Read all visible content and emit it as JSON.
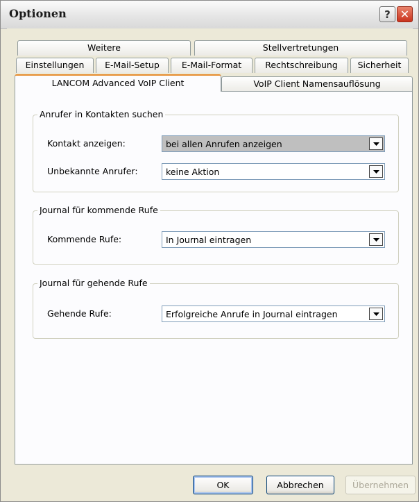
{
  "window": {
    "title": "Optionen"
  },
  "titlebar_buttons": {
    "help": "?",
    "close": "✕"
  },
  "tabs": {
    "row1": [
      "Weitere",
      "Stellvertretungen"
    ],
    "row2": [
      "Einstellungen",
      "E-Mail-Setup",
      "E-Mail-Format",
      "Rechtschreibung",
      "Sicherheit"
    ],
    "row3": [
      "LANCOM Advanced VoIP Client",
      "VoIP Client Namensauflösung"
    ],
    "active": "LANCOM Advanced VoIP Client"
  },
  "groups": {
    "contacts": {
      "title": "Anrufer in Kontakten suchen",
      "show_contact_label": "Kontakt anzeigen:",
      "show_contact_value": "bei allen Anrufen anzeigen",
      "unknown_callers_label": "Unbekannte Anrufer:",
      "unknown_callers_value": "keine Aktion"
    },
    "incoming": {
      "title": "Journal für kommende Rufe",
      "label": "Kommende Rufe:",
      "value": "In Journal eintragen"
    },
    "outgoing": {
      "title": "Journal für gehende Rufe",
      "label": "Gehende Rufe:",
      "value": "Erfolgreiche Anrufe in Journal eintragen"
    }
  },
  "buttons": {
    "ok": "OK",
    "cancel": "Abbrechen",
    "apply": "Übernehmen"
  }
}
